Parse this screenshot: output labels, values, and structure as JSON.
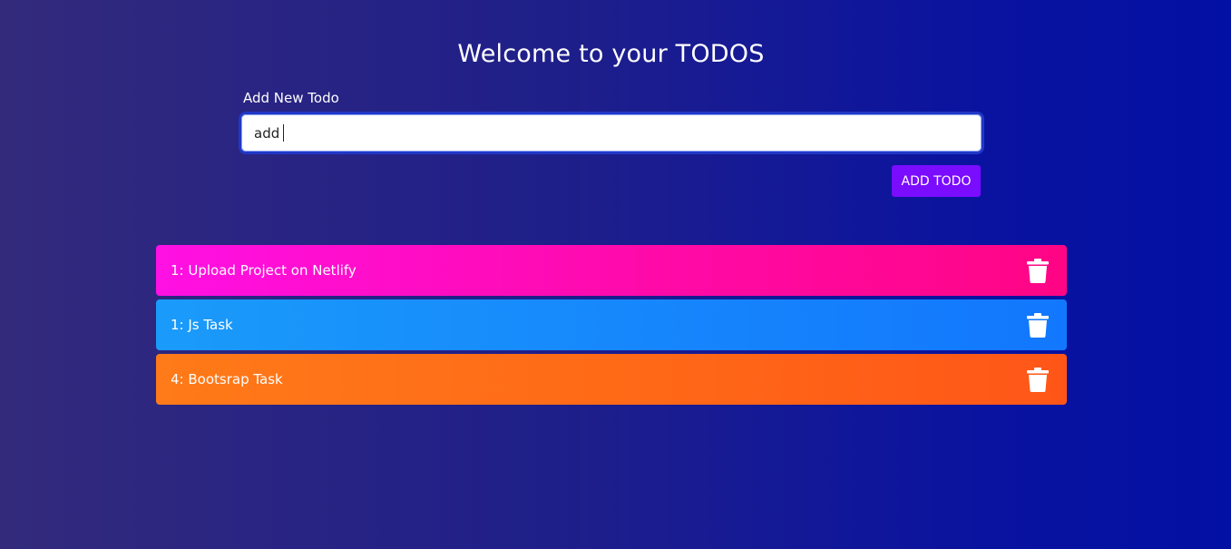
{
  "header": {
    "title": "Welcome to your TODOS"
  },
  "form": {
    "label": "Add New Todo",
    "input_value": "add",
    "button_label": "ADD TODO"
  },
  "todos": [
    {
      "text": "1: Upload Project on Netlify",
      "color": "#ff10e4"
    },
    {
      "text": "1: Js Task",
      "color": "#1a9bfa"
    },
    {
      "text": "4: Bootsrap Task",
      "color": "#ff7a18"
    }
  ],
  "icons": {
    "delete": "trash-icon"
  }
}
